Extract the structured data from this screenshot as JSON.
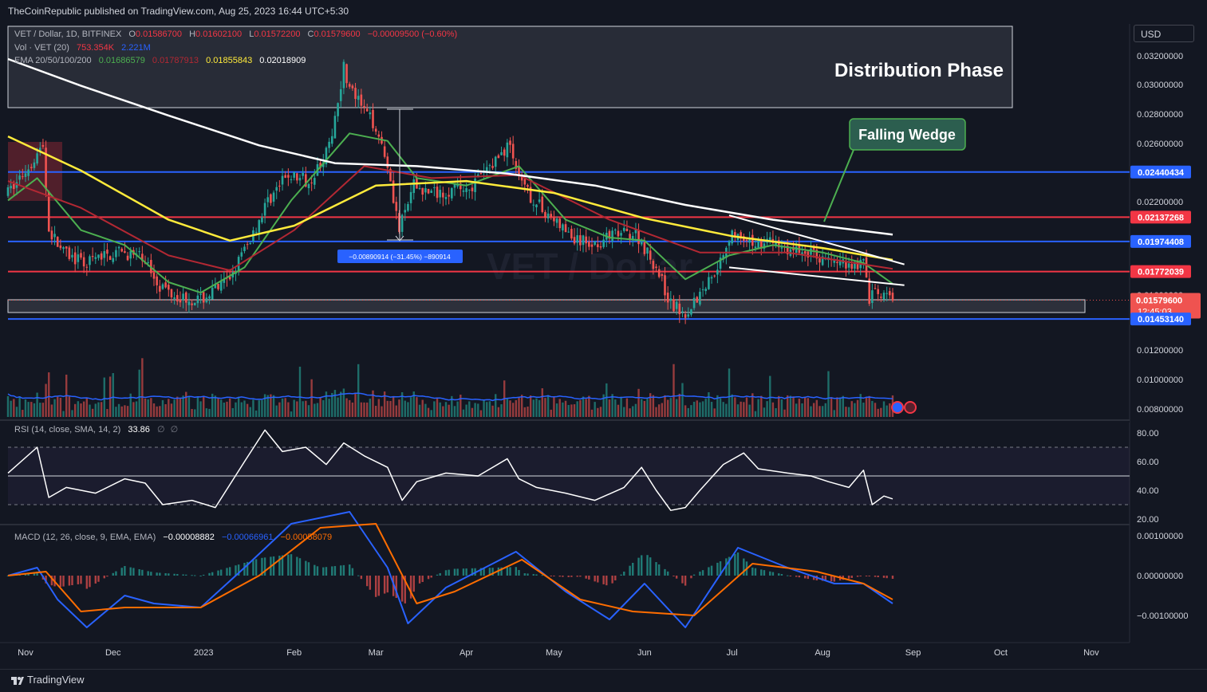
{
  "publisher_line": "TheCoinRepublic published on TradingView.com, Aug 25, 2023 16:44 UTC+5:30",
  "currency": "USD",
  "footer_brand": "TradingView",
  "colors": {
    "bg": "#131722",
    "up": "#26a69a",
    "down": "#ef5350",
    "blue_level": "#2962ff",
    "red_level": "#f23645",
    "ema20": "#4caf50",
    "ema50": "#b22833",
    "ema100": "#ffeb3b",
    "ema200": "#ffffff",
    "macd": "#2962ff",
    "signal": "#ff6d00",
    "rsi": "#ffffff",
    "vol_ma": "#2962ff"
  },
  "legend": {
    "symbol": "VET / Dollar, 1D, BITFINEX",
    "ohlc": [
      {
        "k": "O",
        "v": "0.01586700"
      },
      {
        "k": "H",
        "v": "0.01602100"
      },
      {
        "k": "L",
        "v": "0.01572200"
      },
      {
        "k": "C",
        "v": "0.01579600"
      }
    ],
    "change": "−0.00009500 (−0.60%)",
    "vol_label": "Vol · VET (20)",
    "vol_value": "753.354K",
    "vol_ma_value": "2.221M",
    "ema_label": "EMA 20/50/100/200",
    "ema_values": [
      "0.01686579",
      "0.01787913",
      "0.01855843",
      "0.02018909"
    ]
  },
  "annotations": {
    "distribution": "Distribution Phase",
    "wedge": "Falling Wedge",
    "measure": "−0.00890914 (−31.45%) −890914"
  },
  "chart_data": [
    {
      "type": "candlestick",
      "title": "VET / Dollar, 1D, BITFINEX",
      "ylim": [
        0.0072,
        0.0334
      ],
      "y_ticks": [
        "0.03200000",
        "0.03000000",
        "0.02800000",
        "0.02600000",
        "0.02400000",
        "0.02200000",
        "0.01600000",
        "0.01400000",
        "0.01200000",
        "0.01000000",
        "0.00800000"
      ],
      "x_ticks": [
        "Nov",
        "Dec",
        "2023",
        "Feb",
        "Mar",
        "Apr",
        "May",
        "Jun",
        "Jul",
        "Aug",
        "Sep",
        "Oct",
        "Nov"
      ],
      "levels": [
        {
          "name": "resistance",
          "value": 0.02440434,
          "label": "0.02440434",
          "color": "#2962ff"
        },
        {
          "name": "resistance",
          "value": 0.02137268,
          "label": "0.02137268",
          "color": "#f23645"
        },
        {
          "name": "support",
          "value": 0.01974408,
          "label": "0.01974408",
          "color": "#2962ff"
        },
        {
          "name": "support",
          "value": 0.01772039,
          "label": "0.01772039",
          "color": "#f23645"
        },
        {
          "name": "support",
          "value": 0.0145314,
          "label": "0.01453140",
          "color": "#2962ff"
        }
      ],
      "last_price": {
        "value": 0.015796,
        "label": "0.01579600",
        "countdown": "12:45:03"
      },
      "series": [
        {
          "name": "Price",
          "points": [
            [
              "2022-10-26",
              0.023
            ],
            [
              "2022-11-01",
              0.0245
            ],
            [
              "2022-11-07",
              0.0262
            ],
            [
              "2022-11-09",
              0.0205
            ],
            [
              "2022-11-14",
              0.019
            ],
            [
              "2022-11-21",
              0.0182
            ],
            [
              "2022-11-28",
              0.0188
            ],
            [
              "2022-12-05",
              0.019
            ],
            [
              "2022-12-12",
              0.0185
            ],
            [
              "2022-12-17",
              0.0168
            ],
            [
              "2022-12-24",
              0.016
            ],
            [
              "2022-12-31",
              0.0158
            ],
            [
              "2023-01-09",
              0.017
            ],
            [
              "2023-01-16",
              0.0195
            ],
            [
              "2023-01-23",
              0.0225
            ],
            [
              "2023-01-30",
              0.0242
            ],
            [
              "2023-02-06",
              0.0238
            ],
            [
              "2023-02-13",
              0.026
            ],
            [
              "2023-02-18",
              0.0315
            ],
            [
              "2023-02-20",
              0.03
            ],
            [
              "2023-02-25",
              0.0285
            ],
            [
              "2023-03-01",
              0.0275
            ],
            [
              "2023-03-05",
              0.025
            ],
            [
              "2023-03-09",
              0.0205
            ],
            [
              "2023-03-14",
              0.0235
            ],
            [
              "2023-03-20",
              0.023
            ],
            [
              "2023-03-27",
              0.0232
            ],
            [
              "2023-04-03",
              0.0235
            ],
            [
              "2023-04-10",
              0.025
            ],
            [
              "2023-04-16",
              0.0263
            ],
            [
              "2023-04-19",
              0.0238
            ],
            [
              "2023-04-24",
              0.0225
            ],
            [
              "2023-05-01",
              0.0212
            ],
            [
              "2023-05-08",
              0.0198
            ],
            [
              "2023-05-15",
              0.0196
            ],
            [
              "2023-05-22",
              0.0202
            ],
            [
              "2023-05-29",
              0.0203
            ],
            [
              "2023-06-05",
              0.018
            ],
            [
              "2023-06-10",
              0.0155
            ],
            [
              "2023-06-15",
              0.015
            ],
            [
              "2023-06-21",
              0.0165
            ],
            [
              "2023-06-27",
              0.0185
            ],
            [
              "2023-07-01",
              0.0205
            ],
            [
              "2023-07-05",
              0.0195
            ],
            [
              "2023-07-13",
              0.0198
            ],
            [
              "2023-07-20",
              0.0192
            ],
            [
              "2023-07-27",
              0.019
            ],
            [
              "2023-08-03",
              0.0185
            ],
            [
              "2023-08-10",
              0.0182
            ],
            [
              "2023-08-15",
              0.0183
            ],
            [
              "2023-08-17",
              0.016
            ],
            [
              "2023-08-20",
              0.0162
            ],
            [
              "2023-08-25",
              0.0158
            ]
          ]
        },
        {
          "name": "EMA 20",
          "points": [
            [
              "2022-10-26",
              0.0225
            ],
            [
              "2022-11-05",
              0.024
            ],
            [
              "2022-11-20",
              0.0205
            ],
            [
              "2022-12-05",
              0.0195
            ],
            [
              "2022-12-20",
              0.017
            ],
            [
              "2022-12-31",
              0.0163
            ],
            [
              "2023-01-15",
              0.018
            ],
            [
              "2023-01-31",
              0.0225
            ],
            [
              "2023-02-20",
              0.027
            ],
            [
              "2023-03-05",
              0.0265
            ],
            [
              "2023-03-15",
              0.024
            ],
            [
              "2023-04-01",
              0.0235
            ],
            [
              "2023-04-19",
              0.0248
            ],
            [
              "2023-05-05",
              0.0212
            ],
            [
              "2023-05-20",
              0.02
            ],
            [
              "2023-06-01",
              0.0198
            ],
            [
              "2023-06-15",
              0.0172
            ],
            [
              "2023-06-30",
              0.0188
            ],
            [
              "2023-07-15",
              0.0195
            ],
            [
              "2023-08-01",
              0.019
            ],
            [
              "2023-08-15",
              0.0183
            ],
            [
              "2023-08-25",
              0.0169
            ]
          ]
        },
        {
          "name": "EMA 50",
          "points": [
            [
              "2022-10-26",
              0.0238
            ],
            [
              "2022-11-20",
              0.022
            ],
            [
              "2022-12-20",
              0.0188
            ],
            [
              "2023-01-10",
              0.0178
            ],
            [
              "2023-02-01",
              0.0205
            ],
            [
              "2023-02-25",
              0.0248
            ],
            [
              "2023-03-20",
              0.024
            ],
            [
              "2023-04-19",
              0.0242
            ],
            [
              "2023-05-20",
              0.0212
            ],
            [
              "2023-06-20",
              0.019
            ],
            [
              "2023-07-20",
              0.019
            ],
            [
              "2023-08-25",
              0.0179
            ]
          ]
        },
        {
          "name": "EMA 100",
          "points": [
            [
              "2022-10-26",
              0.0268
            ],
            [
              "2022-11-20",
              0.0245
            ],
            [
              "2022-12-20",
              0.0212
            ],
            [
              "2023-01-10",
              0.0198
            ],
            [
              "2023-02-01",
              0.0208
            ],
            [
              "2023-03-01",
              0.0235
            ],
            [
              "2023-04-01",
              0.0238
            ],
            [
              "2023-05-01",
              0.023
            ],
            [
              "2023-06-01",
              0.0213
            ],
            [
              "2023-07-01",
              0.0201
            ],
            [
              "2023-08-01",
              0.0193
            ],
            [
              "2023-08-25",
              0.0185
            ]
          ]
        },
        {
          "name": "EMA 200",
          "points": [
            [
              "2022-10-26",
              0.032
            ],
            [
              "2022-11-20",
              0.0302
            ],
            [
              "2022-12-20",
              0.0282
            ],
            [
              "2023-01-20",
              0.0262
            ],
            [
              "2023-02-15",
              0.025
            ],
            [
              "2023-03-15",
              0.0248
            ],
            [
              "2023-04-15",
              0.0243
            ],
            [
              "2023-05-15",
              0.0235
            ],
            [
              "2023-06-15",
              0.0222
            ],
            [
              "2023-07-15",
              0.0212
            ],
            [
              "2023-08-25",
              0.0202
            ]
          ]
        }
      ],
      "wedge_upper": [
        [
          "2023-06-30",
          0.0215
        ],
        [
          "2023-08-29",
          0.0182
        ]
      ],
      "wedge_lower": [
        [
          "2023-06-30",
          0.018
        ],
        [
          "2023-08-29",
          0.0168
        ]
      ]
    },
    {
      "type": "bar",
      "title": "Vol · VET (20)",
      "pattern": "daily volume bars colored by candle direction, spikes in early Nov 2022, Feb 2023, Jun 2023 and mid-Aug 2023"
    },
    {
      "type": "line",
      "title": "RSI (14, close, SMA, 14, 2)",
      "value": "33.86",
      "extras": [
        "∅",
        "∅"
      ],
      "y_ticks": [
        "80.00",
        "60.00",
        "40.00",
        "20.00"
      ],
      "ylim": [
        15,
        88
      ],
      "bands": [
        70,
        50,
        30
      ],
      "points": [
        [
          "2022-10-26",
          52
        ],
        [
          "2022-11-05",
          70
        ],
        [
          "2022-11-09",
          35
        ],
        [
          "2022-11-15",
          42
        ],
        [
          "2022-11-25",
          38
        ],
        [
          "2022-12-05",
          48
        ],
        [
          "2022-12-12",
          45
        ],
        [
          "2022-12-18",
          30
        ],
        [
          "2022-12-28",
          33
        ],
        [
          "2023-01-05",
          28
        ],
        [
          "2023-01-15",
          60
        ],
        [
          "2023-01-22",
          82
        ],
        [
          "2023-01-28",
          67
        ],
        [
          "2023-02-05",
          70
        ],
        [
          "2023-02-12",
          58
        ],
        [
          "2023-02-18",
          73
        ],
        [
          "2023-02-25",
          64
        ],
        [
          "2023-03-05",
          56
        ],
        [
          "2023-03-10",
          33
        ],
        [
          "2023-03-15",
          46
        ],
        [
          "2023-03-25",
          52
        ],
        [
          "2023-04-05",
          50
        ],
        [
          "2023-04-15",
          62
        ],
        [
          "2023-04-19",
          48
        ],
        [
          "2023-04-25",
          42
        ],
        [
          "2023-05-05",
          38
        ],
        [
          "2023-05-15",
          33
        ],
        [
          "2023-05-25",
          42
        ],
        [
          "2023-05-31",
          56
        ],
        [
          "2023-06-05",
          40
        ],
        [
          "2023-06-10",
          26
        ],
        [
          "2023-06-15",
          28
        ],
        [
          "2023-06-20",
          40
        ],
        [
          "2023-06-28",
          58
        ],
        [
          "2023-07-05",
          66
        ],
        [
          "2023-07-10",
          55
        ],
        [
          "2023-07-20",
          52
        ],
        [
          "2023-07-28",
          50
        ],
        [
          "2023-08-03",
          46
        ],
        [
          "2023-08-10",
          42
        ],
        [
          "2023-08-15",
          54
        ],
        [
          "2023-08-18",
          30
        ],
        [
          "2023-08-22",
          36
        ],
        [
          "2023-08-25",
          34
        ]
      ]
    },
    {
      "type": "line",
      "title": "MACD (12, 26, close, 9, EMA, EMA)",
      "values": [
        "−0.00008882",
        "−0.00066961",
        "−0.00058079"
      ],
      "y_ticks": [
        "0.00100000",
        "0.00000000",
        "−0.00100000"
      ],
      "ylim": [
        -0.0014,
        0.0011
      ],
      "series": [
        {
          "name": "MACD",
          "points": [
            [
              "2022-10-26",
              0.0
            ],
            [
              "2022-11-05",
              0.0002
            ],
            [
              "2022-11-12",
              -0.0006
            ],
            [
              "2022-11-22",
              -0.0013
            ],
            [
              "2022-12-05",
              -0.0005
            ],
            [
              "2022-12-15",
              -0.0007
            ],
            [
              "2022-12-31",
              -0.0008
            ],
            [
              "2023-01-15",
              0.0002
            ],
            [
              "2023-01-31",
              0.0013
            ],
            [
              "2023-02-20",
              0.0016
            ],
            [
              "2023-03-05",
              0.0002
            ],
            [
              "2023-03-12",
              -0.0012
            ],
            [
              "2023-03-25",
              -0.0003
            ],
            [
              "2023-04-10",
              0.0003
            ],
            [
              "2023-04-18",
              0.0006
            ],
            [
              "2023-05-05",
              -0.0004
            ],
            [
              "2023-05-20",
              -0.0011
            ],
            [
              "2023-06-01",
              -0.0002
            ],
            [
              "2023-06-15",
              -0.0013
            ],
            [
              "2023-07-03",
              0.0007
            ],
            [
              "2023-07-20",
              0.0002
            ],
            [
              "2023-08-05",
              -0.0002
            ],
            [
              "2023-08-15",
              -0.0002
            ],
            [
              "2023-08-25",
              -0.0007
            ]
          ]
        },
        {
          "name": "Signal",
          "points": [
            [
              "2022-10-26",
              0.0
            ],
            [
              "2022-11-08",
              0.0001
            ],
            [
              "2022-11-20",
              -0.0009
            ],
            [
              "2022-12-05",
              -0.0008
            ],
            [
              "2022-12-31",
              -0.0008
            ],
            [
              "2023-01-20",
              0.0
            ],
            [
              "2023-02-10",
              0.0012
            ],
            [
              "2023-03-01",
              0.0013
            ],
            [
              "2023-03-15",
              -0.0007
            ],
            [
              "2023-03-28",
              -0.0004
            ],
            [
              "2023-04-20",
              0.0004
            ],
            [
              "2023-05-10",
              -0.0006
            ],
            [
              "2023-05-28",
              -0.0009
            ],
            [
              "2023-06-18",
              -0.001
            ],
            [
              "2023-07-08",
              0.0003
            ],
            [
              "2023-07-30",
              0.0001
            ],
            [
              "2023-08-15",
              -0.0002
            ],
            [
              "2023-08-25",
              -0.0006
            ]
          ]
        }
      ]
    }
  ]
}
